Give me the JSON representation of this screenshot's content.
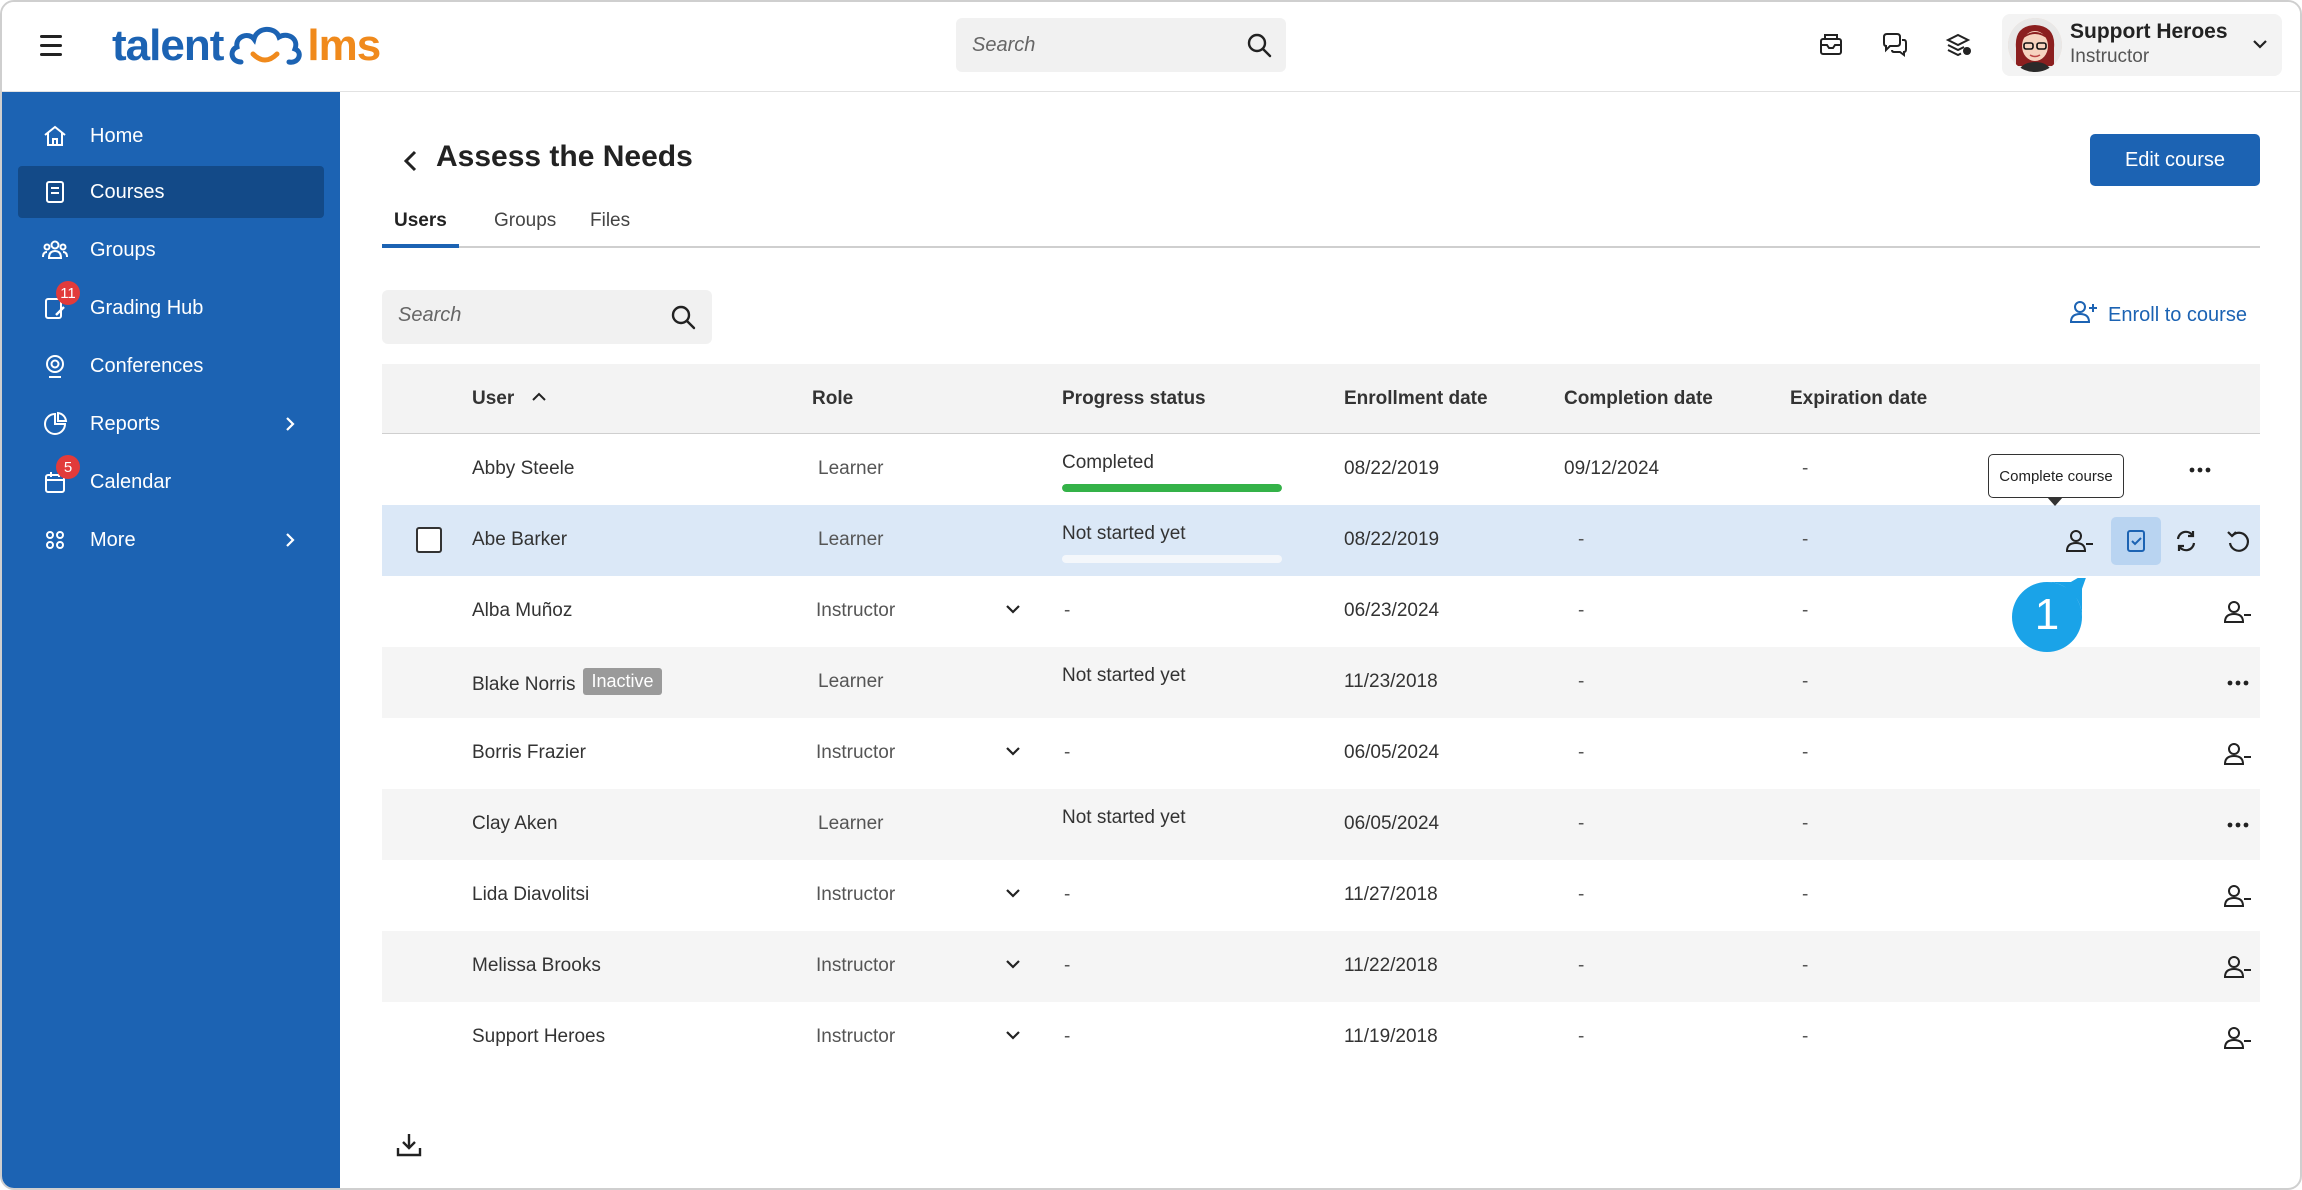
{
  "header": {
    "logo_left": "talent",
    "logo_right": "lms",
    "search_placeholder": "Search",
    "icons": [
      "messages-icon",
      "chat-icon",
      "gift-icon"
    ],
    "user": {
      "name": "Support Heroes",
      "role": "Instructor"
    }
  },
  "sidebar": {
    "items": [
      {
        "label": "Home",
        "icon": "home-icon"
      },
      {
        "label": "Courses",
        "icon": "courses-icon",
        "active": true
      },
      {
        "label": "Groups",
        "icon": "groups-icon"
      },
      {
        "label": "Grading Hub",
        "icon": "grading-hub-icon",
        "badge": "11"
      },
      {
        "label": "Conferences",
        "icon": "conferences-icon"
      },
      {
        "label": "Reports",
        "icon": "reports-icon",
        "has_submenu": true
      },
      {
        "label": "Calendar",
        "icon": "calendar-icon",
        "badge": "5"
      },
      {
        "label": "More",
        "icon": "more-grid-icon",
        "has_submenu": true
      }
    ]
  },
  "page": {
    "title": "Assess the Needs",
    "edit_button": "Edit course",
    "tabs": [
      "Users",
      "Groups",
      "Files"
    ],
    "active_tab": "Users",
    "search_placeholder": "Search",
    "enroll_label": "Enroll to course",
    "tooltip": "Complete course",
    "marker": "1"
  },
  "table": {
    "headers": {
      "user": "User",
      "role": "Role",
      "progress": "Progress status",
      "enrollment": "Enrollment date",
      "completion": "Completion date",
      "expiration": "Expiration date"
    },
    "rows": [
      {
        "user": "Abby Steele",
        "role": "Learner",
        "progress": "Completed",
        "progress_value": 1.0,
        "enrollment": "08/22/2019",
        "completion": "09/12/2024",
        "expiration": "-",
        "actions": "more"
      },
      {
        "user": "Abe Barker",
        "role": "Learner",
        "progress": "Not started yet",
        "progress_value": 0.0,
        "enrollment": "08/22/2019",
        "completion": "-",
        "expiration": "-",
        "actions": "full",
        "selected": true
      },
      {
        "user": "Alba Muñoz",
        "role": "Instructor",
        "progress": "-",
        "enrollment": "06/23/2024",
        "completion": "-",
        "expiration": "-",
        "actions": "unenroll"
      },
      {
        "user": "Blake Norris",
        "badge": "Inactive",
        "role": "Learner",
        "progress": "Not started yet",
        "enrollment": "11/23/2018",
        "completion": "-",
        "expiration": "-",
        "actions": "more"
      },
      {
        "user": "Borris Frazier",
        "role": "Instructor",
        "progress": "-",
        "enrollment": "06/05/2024",
        "completion": "-",
        "expiration": "-",
        "actions": "unenroll"
      },
      {
        "user": "Clay Aken",
        "role": "Learner",
        "progress": "Not started yet",
        "enrollment": "06/05/2024",
        "completion": "-",
        "expiration": "-",
        "actions": "more"
      },
      {
        "user": "Lida Diavolitsi",
        "role": "Instructor",
        "progress": "-",
        "enrollment": "11/27/2018",
        "completion": "-",
        "expiration": "-",
        "actions": "unenroll"
      },
      {
        "user": "Melissa Brooks",
        "role": "Instructor",
        "progress": "-",
        "enrollment": "11/22/2018",
        "completion": "-",
        "expiration": "-",
        "actions": "unenroll"
      },
      {
        "user": "Support Heroes",
        "role": "Instructor",
        "progress": "-",
        "enrollment": "11/19/2018",
        "completion": "-",
        "expiration": "-",
        "actions": "unenroll"
      }
    ]
  },
  "colors": {
    "brand_blue": "#1c63b3",
    "brand_orange": "#f08a1c",
    "sidebar_active": "#134a88",
    "progress_green": "#34b248",
    "badge_red": "#e23b3b",
    "marker_blue": "#1aa3e8"
  }
}
